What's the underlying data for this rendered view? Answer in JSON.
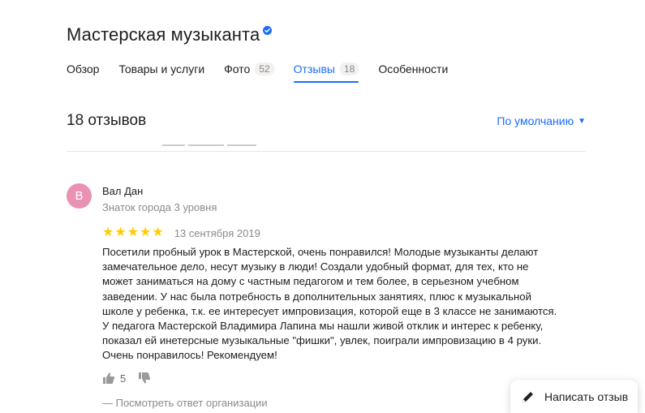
{
  "org": {
    "title": "Мастерская музыканта",
    "verified_icon": "verified-check-icon"
  },
  "tabs": [
    {
      "label": "Обзор",
      "count": ""
    },
    {
      "label": "Товары и услуги",
      "count": ""
    },
    {
      "label": "Фото",
      "count": "52"
    },
    {
      "label": "Отзывы",
      "count": "18",
      "active": true
    },
    {
      "label": "Особенности",
      "count": ""
    }
  ],
  "reviews": {
    "count_label": "18 отзывов",
    "sort_label": "По умолчанию"
  },
  "review": {
    "avatar_letter": "В",
    "avatar_color": "#e992b4",
    "author": "Вал Дан",
    "level": "Знаток города 3 уровня",
    "rating": 5,
    "date": "13 сентября 2019",
    "text": [
      "Посетили пробный урок в Мастерской, очень понравился! Молодые музыканты делают",
      "замечательное дело, несут музыку в люди! Создали удобный формат, для тех, кто не",
      "может заниматься на дому с частным педагогом и тем более, в серьезном учебном",
      "заведении. У нас была потребность в дополнительных занятиях, плюс к музыкальной",
      "школе у ребенка, т.к. ее интересует импровизация, которой еще в 3 классе не занимаются.",
      "У педагога Мастерской Владимира Лапина мы нашли живой отклик и интерес к ребенку,",
      "показал ей инетерсные музыкальные \"фишки\", увлек, поиграли импровизацию в 4 руки.",
      "Очень понравилось! Рекомендуем!"
    ],
    "likes": "5",
    "org_reply_label": "— Посмотреть ответ организации"
  },
  "write_review": {
    "label": "Написать отзыв"
  },
  "colors": {
    "accent": "#196dff",
    "star": "#ffcc00",
    "muted": "#8a8a8a"
  }
}
